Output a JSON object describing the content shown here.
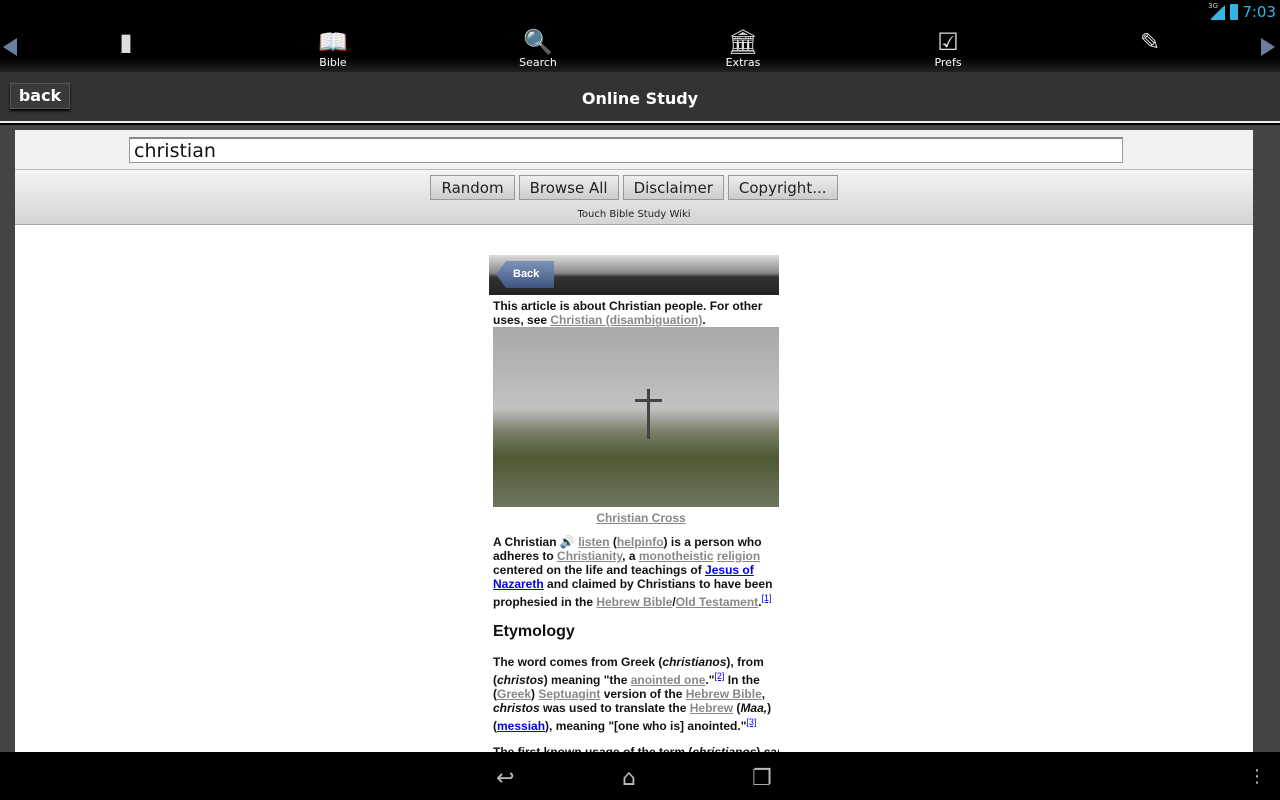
{
  "status": {
    "network": "3G",
    "time": "7:03"
  },
  "toolbar": {
    "items": [
      {
        "label": "",
        "icon": "bookmark-icon",
        "glyph": "▮"
      },
      {
        "label": "Bible",
        "icon": "book-icon",
        "glyph": "📖"
      },
      {
        "label": "Search",
        "icon": "magnifier-icon",
        "glyph": "🔍"
      },
      {
        "label": "Extras",
        "icon": "temple-icon",
        "glyph": "🏛"
      },
      {
        "label": "Prefs",
        "icon": "checklist-icon",
        "glyph": "☑"
      },
      {
        "label": "",
        "icon": "pencil-icon",
        "glyph": "✎"
      }
    ]
  },
  "header": {
    "back": "back",
    "title": "Online Study"
  },
  "search": {
    "value": "christian"
  },
  "buttons": [
    "Random",
    "Browse All",
    "Disclaimer",
    "Copyright..."
  ],
  "wiki_label": "Touch Bible Study Wiki",
  "article": {
    "back": "Back",
    "hatnote": [
      [
        "t",
        "This article is about Christian people. For other uses, see "
      ],
      [
        "g",
        "Christian (disambiguation)"
      ],
      [
        "t",
        "."
      ]
    ],
    "caption": "Christian Cross",
    "para1": [
      [
        "t",
        "A Christian "
      ],
      [
        "t",
        "🔊 "
      ],
      [
        "g",
        "listen"
      ],
      [
        "t",
        " ("
      ],
      [
        "g",
        "helpinfo"
      ],
      [
        "t",
        ") is a person who adheres to "
      ],
      [
        "g",
        "Christianity"
      ],
      [
        "t",
        ", a "
      ],
      [
        "g",
        "monotheistic"
      ],
      [
        "t",
        " "
      ],
      [
        "g",
        "religion"
      ],
      [
        "t",
        " centered on the life and teachings of "
      ],
      [
        "b",
        "Jesus of Nazareth"
      ],
      [
        "t",
        " and claimed by Christians to have been prophesied in the "
      ],
      [
        "g",
        "Hebrew Bible"
      ],
      [
        "t",
        "/"
      ],
      [
        "g",
        "Old Testament"
      ],
      [
        "t",
        "."
      ],
      [
        "s",
        "[1]"
      ]
    ],
    "heading": "Etymology",
    "para2": [
      [
        "t",
        "The word comes from Greek ("
      ],
      [
        "i",
        "christianos"
      ],
      [
        "t",
        "), from ("
      ],
      [
        "i",
        "christos"
      ],
      [
        "t",
        ") meaning \"the "
      ],
      [
        "g",
        "anointed one"
      ],
      [
        "t",
        ".\""
      ],
      [
        "s",
        "[2]"
      ],
      [
        "t",
        " In the ("
      ],
      [
        "g",
        "Greek"
      ],
      [
        "t",
        ") "
      ],
      [
        "g",
        "Septuagint"
      ],
      [
        "t",
        " version of the "
      ],
      [
        "g",
        "Hebrew Bible"
      ],
      [
        "t",
        ", "
      ],
      [
        "i",
        "christos"
      ],
      [
        "t",
        " was used to translate the "
      ],
      [
        "g",
        "Hebrew"
      ],
      [
        "t",
        " ("
      ],
      [
        "i",
        "Maa,"
      ],
      [
        "t",
        ") ("
      ],
      [
        "b",
        "messiah"
      ],
      [
        "t",
        "), meaning \"[one who is] anointed.\""
      ],
      [
        "s",
        "[3]"
      ]
    ],
    "para3": [
      [
        "t",
        "The first known usage of the term ("
      ],
      [
        "i",
        "christianos"
      ],
      [
        "t",
        ") can be"
      ]
    ]
  }
}
